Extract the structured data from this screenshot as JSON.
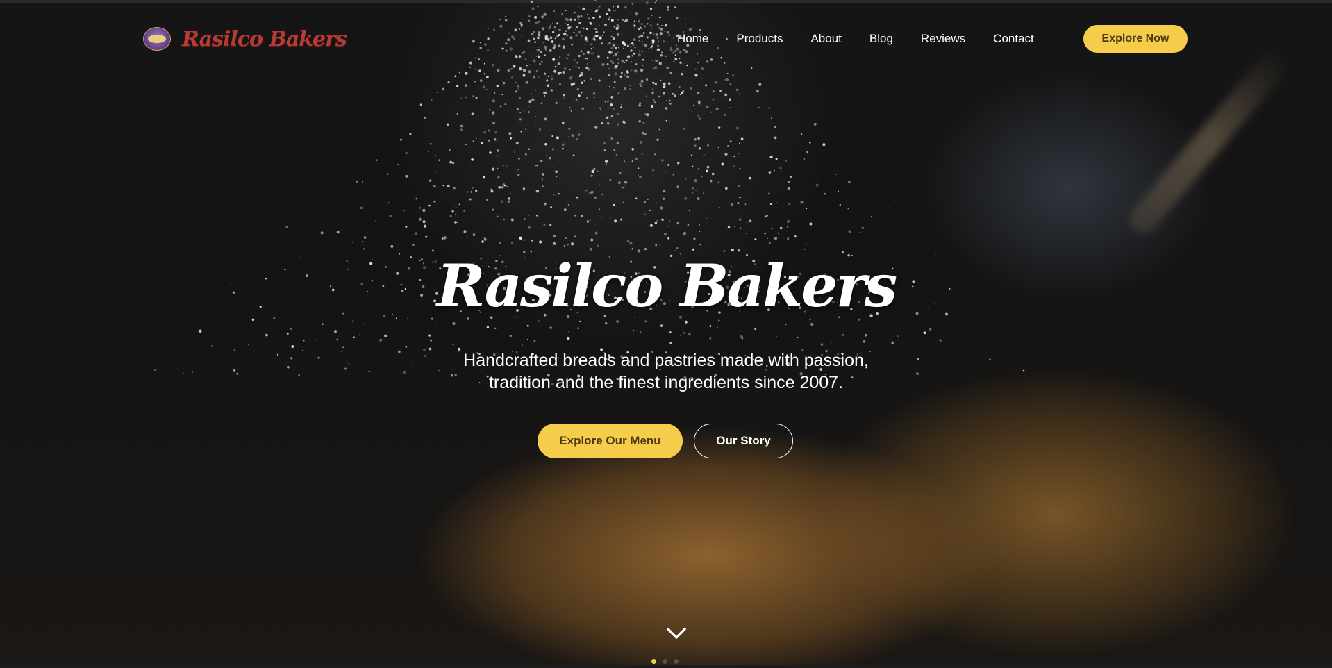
{
  "brand": {
    "name": "Rasilco Bakers",
    "logo_icon": "bakery-logo-badge"
  },
  "nav": {
    "links": [
      "Home",
      "Products",
      "About",
      "Blog",
      "Reviews",
      "Contact"
    ],
    "cta_label": "Explore Now"
  },
  "hero": {
    "title": "Rasilco Bakers",
    "subtitle_line1": "Handcrafted breads and pastries made with passion,",
    "subtitle_line2": "tradition and the finest ingredients since 2007.",
    "primary_button": "Explore Our Menu",
    "secondary_button": "Our Story",
    "scroll_icon": "chevron-down-icon",
    "slides": {
      "count": 3,
      "active_index": 0
    }
  },
  "colors": {
    "accent": "#f5cd4b",
    "accent_text": "#4b3a12",
    "brand_red": "#b83a35",
    "text": "#ffffff",
    "background": "#141414"
  }
}
